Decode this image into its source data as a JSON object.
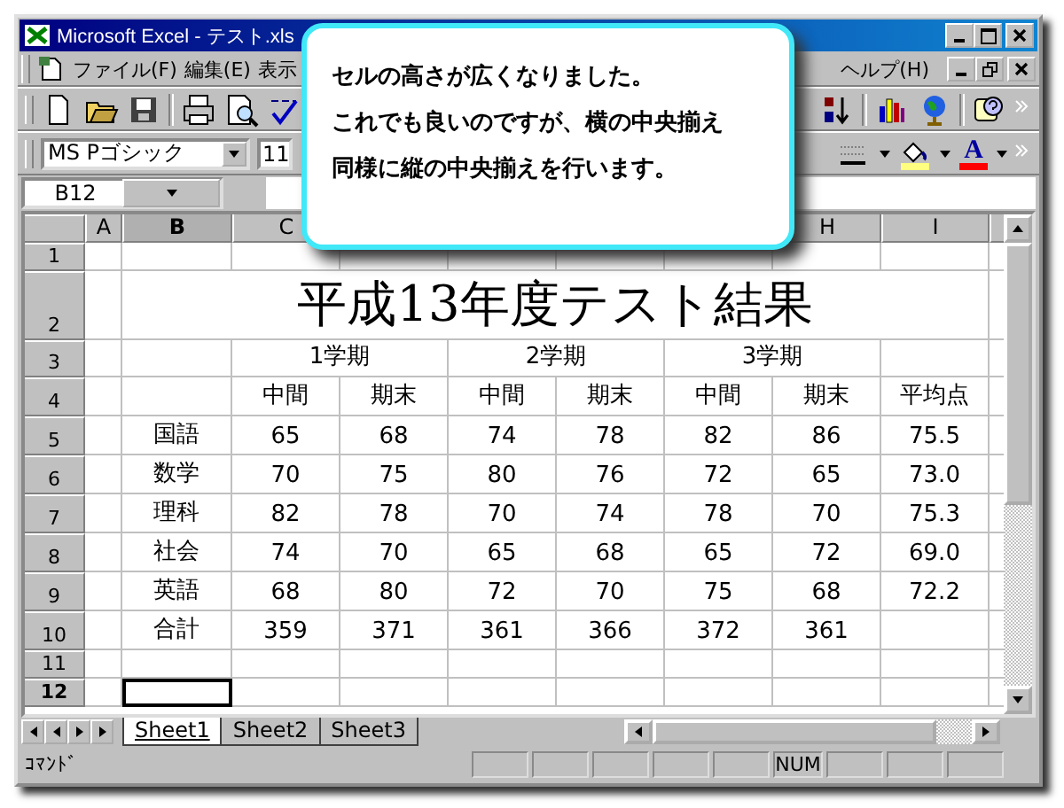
{
  "window": {
    "title": "Microsoft Excel - テスト.xls"
  },
  "menu": {
    "items": [
      "ファイル(F)",
      "編集(E)",
      "表示"
    ],
    "help": "ヘルプ(H)"
  },
  "format_bar": {
    "font": "MS Pゴシック",
    "size": "11",
    "font_color_label": "A"
  },
  "name_box": "B12",
  "columns": {
    "left": [
      {
        "label": "A",
        "selected": false
      },
      {
        "label": "B",
        "selected": true
      },
      {
        "label": "C",
        "selected": false
      }
    ],
    "right": [
      {
        "label": "H",
        "selected": false
      },
      {
        "label": "I",
        "selected": false
      }
    ]
  },
  "rows": [
    {
      "header": "1",
      "kind": "empty",
      "selected": false
    },
    {
      "header": "2",
      "kind": "title",
      "text": "平成13年度テスト結果",
      "selected": false
    },
    {
      "header": "3",
      "kind": "terms",
      "cells": [
        "1学期",
        "2学期",
        "3学期"
      ],
      "selected": false
    },
    {
      "header": "4",
      "kind": "subheader",
      "cells": [
        "中間",
        "期末",
        "中間",
        "期末",
        "中間",
        "期末",
        "平均点"
      ],
      "selected": false
    },
    {
      "header": "5",
      "kind": "data",
      "cells": [
        "国語",
        "65",
        "68",
        "74",
        "78",
        "82",
        "86",
        "75.5"
      ],
      "selected": false
    },
    {
      "header": "6",
      "kind": "data",
      "cells": [
        "数学",
        "70",
        "75",
        "80",
        "76",
        "72",
        "65",
        "73.0"
      ],
      "selected": false
    },
    {
      "header": "7",
      "kind": "data",
      "cells": [
        "理科",
        "82",
        "78",
        "70",
        "74",
        "78",
        "70",
        "75.3"
      ],
      "selected": false
    },
    {
      "header": "8",
      "kind": "data",
      "cells": [
        "社会",
        "74",
        "70",
        "65",
        "68",
        "65",
        "72",
        "69.0"
      ],
      "selected": false
    },
    {
      "header": "9",
      "kind": "data",
      "cells": [
        "英語",
        "68",
        "80",
        "72",
        "70",
        "75",
        "68",
        "72.2"
      ],
      "selected": false
    },
    {
      "header": "10",
      "kind": "data",
      "cells": [
        "合計",
        "359",
        "371",
        "361",
        "366",
        "372",
        "361"
      ],
      "selected": false
    },
    {
      "header": "11",
      "kind": "empty",
      "selected": false
    },
    {
      "header": "12",
      "kind": "empty",
      "selected": true
    }
  ],
  "sheets": [
    {
      "label": "Sheet1",
      "selected": true
    },
    {
      "label": "Sheet2",
      "selected": false
    },
    {
      "label": "Sheet3",
      "selected": false
    }
  ],
  "status_bar": {
    "text": "ｺﾏﾝﾄﾞ",
    "indicator": "NUM"
  },
  "callout": {
    "lines": [
      "セルの高さが広くなりました。",
      "これでも良いのですが、横の中央揃え",
      "同様に縦の中央揃えを行います。"
    ]
  }
}
